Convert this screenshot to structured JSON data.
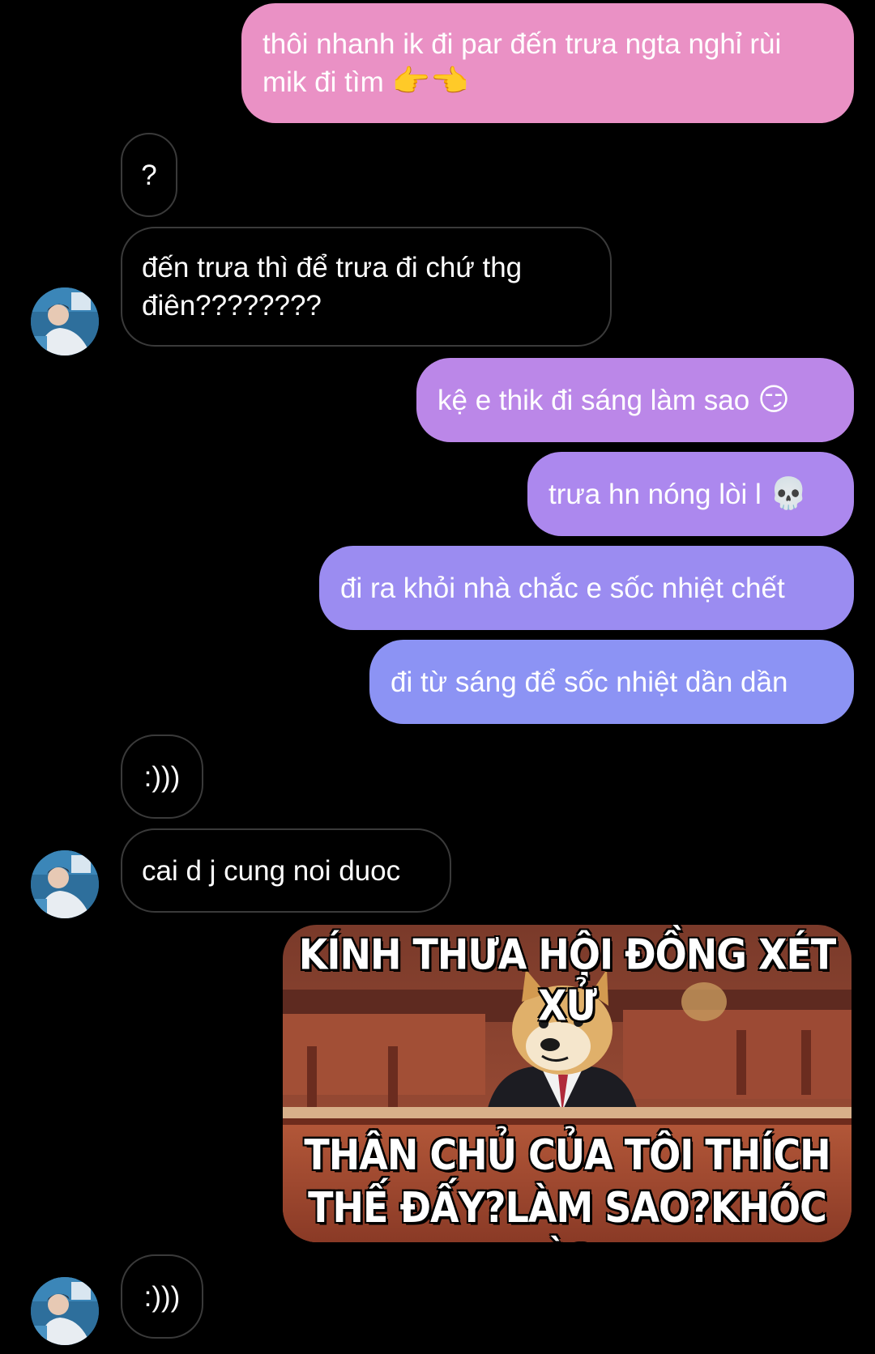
{
  "messages": [
    {
      "from": "me",
      "text": "thôi nhanh ik đi par đến trưa ngta nghỉ rùi mik đi tìm",
      "emoji": "👉👈"
    },
    {
      "from": "them",
      "text": "?"
    },
    {
      "from": "them",
      "text": "đến trưa thì để trưa đi chứ thg điên????????"
    },
    {
      "from": "me",
      "text": "kệ e thik đi sáng làm sao",
      "emoji": "😏"
    },
    {
      "from": "me",
      "text": "trưa hn nóng lòi l",
      "emoji": "💀"
    },
    {
      "from": "me",
      "text": "đi ra khỏi nhà chắc e sốc nhiệt chết"
    },
    {
      "from": "me",
      "text": "đi từ sáng để sốc nhiệt dần dần"
    },
    {
      "from": "them",
      "text": ":)))"
    },
    {
      "from": "them",
      "text": "cai d j cung noi duoc"
    },
    {
      "from": "them",
      "text": ":)))"
    }
  ],
  "meme": {
    "top_text": "KÍNH THƯA HỘI ĐỒNG XÉT XỬ",
    "bottom_line1": "THÂN CHỦ CỦA TÔI THÍCH",
    "bottom_line2": "THẾ ĐẤY?LÀM SAO?KHÓC À?",
    "subject_icon": "doge-lawyer-image"
  },
  "avatar_icon": "contact-avatar",
  "colors": {
    "background": "#000000",
    "received_border": "#3a3a3a",
    "sent_gradient_top": "#ea8ec4",
    "sent_gradient_mid": "#b385ef",
    "sent_gradient_bottom": "#8c93f4"
  }
}
